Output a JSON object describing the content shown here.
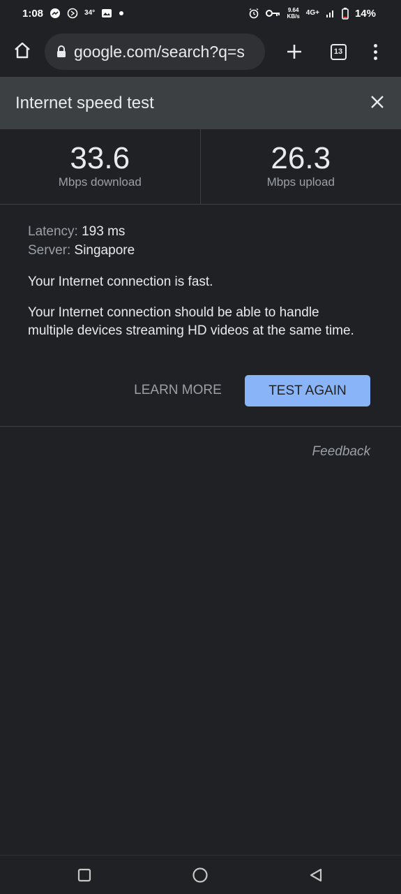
{
  "status_bar": {
    "time": "1:08",
    "temperature": "34°",
    "net_speed_value": "9.64",
    "net_speed_unit": "KB/s",
    "network_type": "4G+",
    "battery": "14%"
  },
  "browser": {
    "url": "google.com/search?q=s",
    "tab_count": "13"
  },
  "card": {
    "title": "Internet speed test",
    "download_value": "33.6",
    "download_label": "Mbps download",
    "upload_value": "26.3",
    "upload_label": "Mbps upload",
    "latency_key": "Latency:",
    "latency_value": "193 ms",
    "server_key": "Server:",
    "server_value": "Singapore",
    "summary": "Your Internet connection is fast.",
    "description": "Your Internet connection should be able to handle multiple devices streaming HD videos at the same time.",
    "learn_more_label": "LEARN MORE",
    "test_again_label": "TEST AGAIN",
    "feedback_label": "Feedback"
  },
  "colors": {
    "background": "#202124",
    "header_bg": "#3c4043",
    "accent_button": "#8ab4f8"
  },
  "icons": {
    "home": "home-icon",
    "lock": "lock-icon",
    "plus": "plus-icon",
    "menu": "more-vert-icon",
    "close": "close-icon",
    "recents": "recents-icon",
    "home_nav": "home-nav-icon",
    "back": "back-icon"
  }
}
